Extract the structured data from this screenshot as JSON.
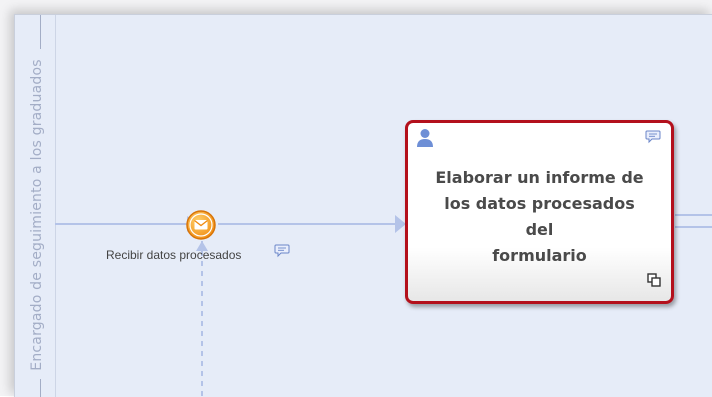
{
  "lane": {
    "label": "Encargado de seguimiento a los graduados"
  },
  "event": {
    "type": "message-intermediate-event",
    "label": "Recibir datos procesados",
    "color": "#f59a1e"
  },
  "task": {
    "label_lines": [
      "Elaborar un informe de",
      "los datos procesados del",
      "formulario"
    ],
    "border_color": "#b3101c"
  },
  "icons": {
    "event_comment": "comment-icon",
    "task_comment": "comment-icon",
    "task_performer": "user-icon",
    "task_subprocess": "subprocess-icon"
  },
  "colors": {
    "canvas": "#e6ecf8",
    "flow_line": "#b4c3e8",
    "lane_text": "#a3adc6"
  }
}
